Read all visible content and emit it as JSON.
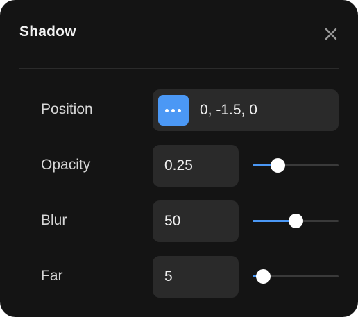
{
  "panel": {
    "title": "Shadow",
    "close_icon": "close-icon"
  },
  "rows": {
    "position": {
      "label": "Position",
      "value": "0, -1.5, 0",
      "button_icon": "more-dots-icon"
    },
    "opacity": {
      "label": "Opacity",
      "value": "0.25",
      "slider_level": 0.29
    },
    "blur": {
      "label": "Blur",
      "value": "50",
      "slider_level": 0.5
    },
    "far": {
      "label": "Far",
      "value": "5",
      "slider_level": 0.12
    }
  },
  "colors": {
    "accent": "#4b98f5",
    "panel_bg": "#141414",
    "field_bg": "#2a2a2a"
  }
}
